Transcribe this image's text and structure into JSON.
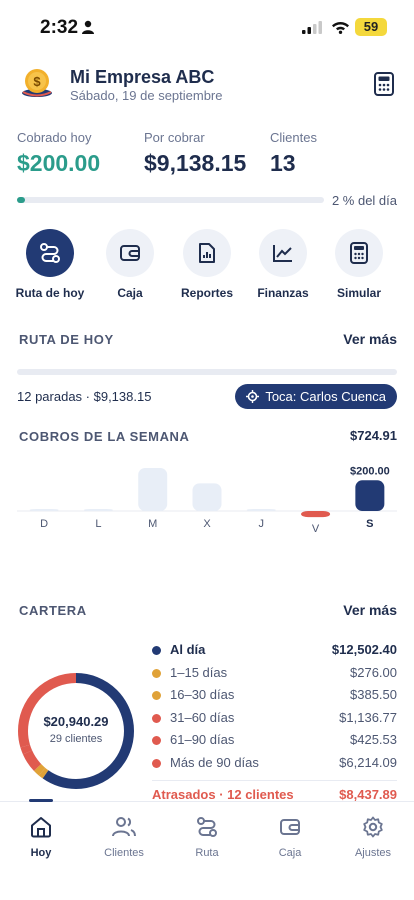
{
  "status_bar": {
    "time": "2:32",
    "battery": "59"
  },
  "header": {
    "company": "Mi Empresa ABC",
    "date": "Sábado, 19 de septiembre"
  },
  "stats": {
    "collected_label": "Cobrado hoy",
    "collected_value": "$200.00",
    "pending_label": "Por cobrar",
    "pending_value": "$9,138.15",
    "clients_label": "Clientes",
    "clients_value": "13"
  },
  "day_progress": {
    "percent": 2,
    "label": "2 % del día"
  },
  "quick_actions": [
    {
      "label": "Ruta de hoy",
      "icon": "route-icon",
      "active": true
    },
    {
      "label": "Caja",
      "icon": "wallet-icon",
      "active": false
    },
    {
      "label": "Reportes",
      "icon": "report-icon",
      "active": false
    },
    {
      "label": "Finanzas",
      "icon": "chart-line-icon",
      "active": false
    },
    {
      "label": "Simular",
      "icon": "calculator-icon",
      "active": false
    }
  ],
  "route": {
    "title": "RUTA DE HOY",
    "see_more": "Ver más",
    "summary": "12 paradas · $9,138.15",
    "chip": "Toca: Carlos Cuenca"
  },
  "weekly": {
    "title": "COBROS DE LA SEMANA",
    "total": "$724.91"
  },
  "chart_data": {
    "type": "bar",
    "categories": [
      "D",
      "L",
      "M",
      "X",
      "J",
      "V",
      "S"
    ],
    "values": [
      0,
      0,
      280,
      180,
      0,
      -40,
      200
    ],
    "highlight_index": 6,
    "labels": {
      "6": "$200.00"
    },
    "colors": {
      "default": "#e8eef7",
      "negative": "#e05a4f",
      "highlight": "#223a74"
    }
  },
  "portfolio": {
    "title": "CARTERA",
    "see_more": "Ver más",
    "total": "$20,940.29",
    "clients": "29 clientes",
    "segments": [
      {
        "label": "Al día",
        "amount": "$12,502.40",
        "value": 12502.4,
        "color": "#223a74"
      },
      {
        "label": "1–15 días",
        "amount": "$276.00",
        "value": 276.0,
        "color": "#e0a238"
      },
      {
        "label": "16–30 días",
        "amount": "$385.50",
        "value": 385.5,
        "color": "#e0a238"
      },
      {
        "label": "31–60 días",
        "amount": "$1,136.77",
        "value": 1136.77,
        "color": "#e05a4f"
      },
      {
        "label": "61–90 días",
        "amount": "$425.53",
        "value": 425.53,
        "color": "#e05a4f"
      },
      {
        "label": "Más de 90 días",
        "amount": "$6,214.09",
        "value": 6214.09,
        "color": "#e05a4f"
      }
    ],
    "overdue_label": "Atrasados · 12 clientes",
    "overdue_amount": "$8,437.89"
  },
  "tabs": [
    {
      "label": "Hoy",
      "icon": "home-icon",
      "active": true
    },
    {
      "label": "Clientes",
      "icon": "users-icon",
      "active": false
    },
    {
      "label": "Ruta",
      "icon": "route-icon",
      "active": false
    },
    {
      "label": "Caja",
      "icon": "wallet-icon",
      "active": false
    },
    {
      "label": "Ajustes",
      "icon": "gear-icon",
      "active": false
    }
  ]
}
